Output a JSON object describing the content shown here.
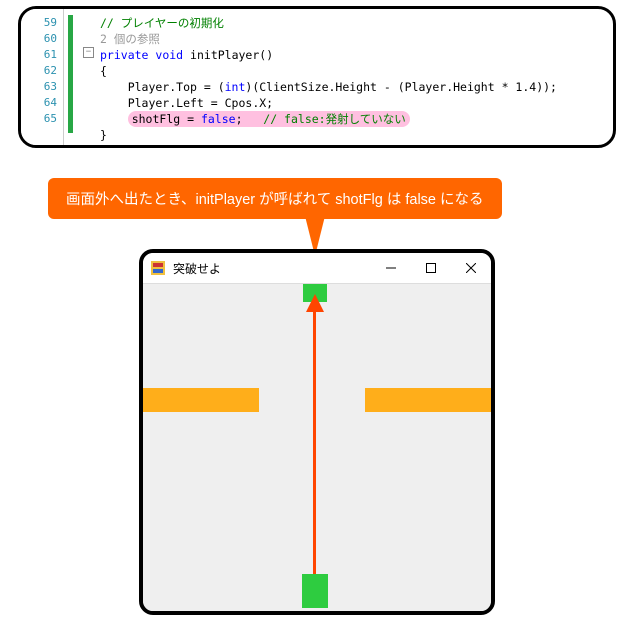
{
  "code": {
    "line_numbers": [
      "59",
      "",
      "60",
      "61",
      "62",
      "63",
      "64",
      "65"
    ],
    "l59_comment": "// プレイヤーの初期化",
    "l59b_ref": "2 個の参照",
    "l60_kw1": "private",
    "l60_kw2": "void",
    "l60_name": "initPlayer",
    "l60_paren": "()",
    "l61": "{",
    "l62_a": "    Player.Top = (",
    "l62_cast": "int",
    "l62_b": ")(ClientSize.Height - (Player.Height * 1.4));",
    "l63": "    Player.Left = Cpos.X;",
    "l64_a": "shotFlg = ",
    "l64_kw": "false",
    "l64_b": ";   ",
    "l64_c": "// false:発射していない",
    "l65": "}"
  },
  "tooltip": {
    "text": "画面外へ出たとき、initPlayer が呼ばれて shotFlg は false になる"
  },
  "window": {
    "title": "突破せよ"
  }
}
